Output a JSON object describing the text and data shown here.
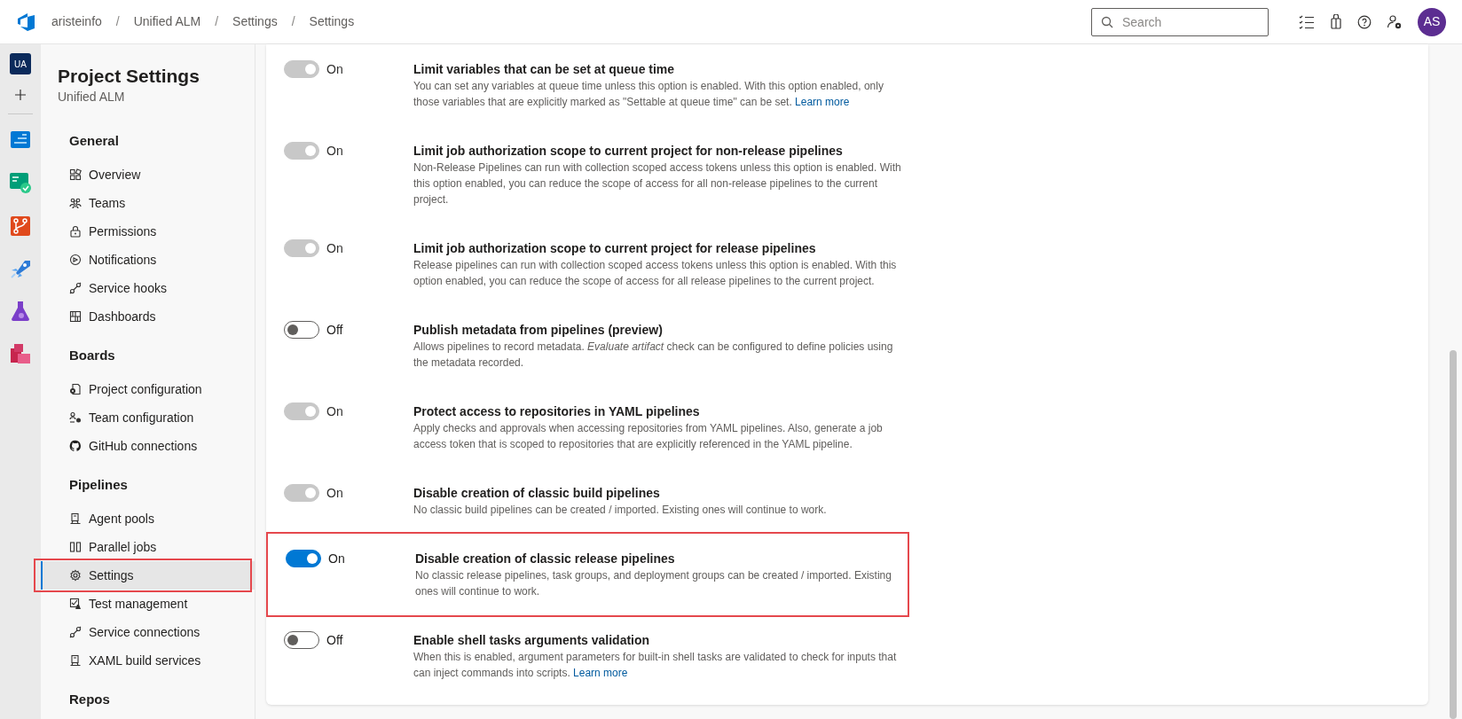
{
  "breadcrumbs": [
    "aristeinfo",
    "Unified ALM",
    "Settings",
    "Settings"
  ],
  "breadcrumb_separator": "/",
  "search": {
    "placeholder": "Search"
  },
  "user": {
    "initials": "AS"
  },
  "project_badge": "UA",
  "sidebar": {
    "title": "Project Settings",
    "subtitle": "Unified ALM",
    "sections": [
      {
        "heading": "General",
        "items": [
          {
            "label": "Overview",
            "selected": false,
            "highlighted": false
          },
          {
            "label": "Teams",
            "selected": false,
            "highlighted": false
          },
          {
            "label": "Permissions",
            "selected": false,
            "highlighted": false
          },
          {
            "label": "Notifications",
            "selected": false,
            "highlighted": false
          },
          {
            "label": "Service hooks",
            "selected": false,
            "highlighted": false
          },
          {
            "label": "Dashboards",
            "selected": false,
            "highlighted": false
          }
        ]
      },
      {
        "heading": "Boards",
        "items": [
          {
            "label": "Project configuration",
            "selected": false,
            "highlighted": false
          },
          {
            "label": "Team configuration",
            "selected": false,
            "highlighted": false
          },
          {
            "label": "GitHub connections",
            "selected": false,
            "highlighted": false
          }
        ]
      },
      {
        "heading": "Pipelines",
        "items": [
          {
            "label": "Agent pools",
            "selected": false,
            "highlighted": false
          },
          {
            "label": "Parallel jobs",
            "selected": false,
            "highlighted": false
          },
          {
            "label": "Settings",
            "selected": true,
            "highlighted": true
          },
          {
            "label": "Test management",
            "selected": false,
            "highlighted": false
          },
          {
            "label": "Service connections",
            "selected": false,
            "highlighted": false
          },
          {
            "label": "XAML build services",
            "selected": false,
            "highlighted": false
          }
        ]
      },
      {
        "heading": "Repos"
      }
    ]
  },
  "settings": [
    {
      "title": "Limit variables that can be set at queue time",
      "description": "You can set any variables at queue time unless this option is enabled. With this option enabled, only those variables that are explicitly marked as \"Settable at queue time\" can be set.",
      "link": "Learn more",
      "on": true,
      "disabled": true,
      "highlighted": false,
      "state_label": "On"
    },
    {
      "title": "Limit job authorization scope to current project for non-release pipelines",
      "description": "Non-Release Pipelines can run with collection scoped access tokens unless this option is enabled. With this option enabled, you can reduce the scope of access for all non-release pipelines to the current project.",
      "on": true,
      "disabled": true,
      "highlighted": false,
      "state_label": "On"
    },
    {
      "title": "Limit job authorization scope to current project for release pipelines",
      "description": "Release pipelines can run with collection scoped access tokens unless this option is enabled. With this option enabled, you can reduce the scope of access for all release pipelines to the current project.",
      "on": true,
      "disabled": true,
      "highlighted": false,
      "state_label": "On"
    },
    {
      "title": "Publish metadata from pipelines (preview)",
      "description": "Allows pipelines to record metadata. *Evaluate artifact* check can be configured to define policies using the metadata recorded.",
      "on": false,
      "disabled": false,
      "highlighted": false,
      "state_label": "Off"
    },
    {
      "title": "Protect access to repositories in YAML pipelines",
      "description": "Apply checks and approvals when accessing repositories from YAML pipelines. Also, generate a job access token that is scoped to repositories that are explicitly referenced in the YAML pipeline.",
      "on": true,
      "disabled": true,
      "highlighted": false,
      "state_label": "On"
    },
    {
      "title": "Disable creation of classic build pipelines",
      "description": "No classic build pipelines can be created / imported. Existing ones will continue to work.",
      "on": true,
      "disabled": true,
      "highlighted": false,
      "state_label": "On"
    },
    {
      "title": "Disable creation of classic release pipelines",
      "description": "No classic release pipelines, task groups, and deployment groups can be created / imported. Existing ones will continue to work.",
      "on": true,
      "disabled": false,
      "highlighted": true,
      "state_label": "On"
    },
    {
      "title": "Enable shell tasks arguments validation",
      "description": "When this is enabled, argument parameters for built-in shell tasks are validated to check for inputs that can inject commands into scripts.",
      "link": "Learn more",
      "on": false,
      "disabled": false,
      "highlighted": false,
      "state_label": "Off"
    }
  ]
}
